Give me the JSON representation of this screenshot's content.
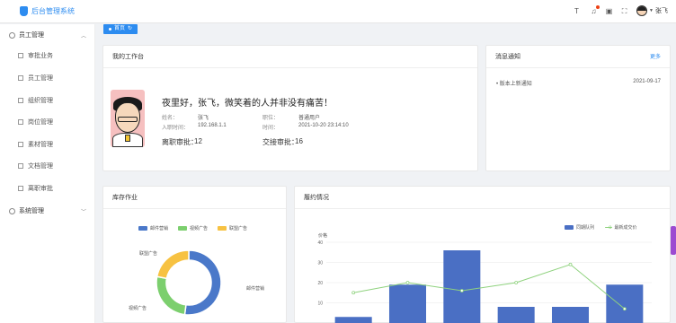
{
  "app": {
    "title": "后台管理系统"
  },
  "user": {
    "name": "张飞"
  },
  "sidebar": {
    "groups": [
      {
        "label": "员工管理",
        "arrow": "^"
      },
      {
        "label": "系统管理",
        "arrow": "v"
      }
    ],
    "items": [
      {
        "label": "审批业务"
      },
      {
        "label": "员工管理"
      },
      {
        "label": "组织管理"
      },
      {
        "label": "岗位管理"
      },
      {
        "label": "素材管理"
      },
      {
        "label": "文档管理"
      },
      {
        "label": "离职审批"
      }
    ]
  },
  "tabs": [
    {
      "label": "首页"
    }
  ],
  "workbench": {
    "title": "我的工作台",
    "greeting": "夜里好，张飞，微笑着的人并非没有痛苦！",
    "fields": {
      "name_label": "姓名：",
      "name_value": "张飞",
      "post_label": "职位：",
      "post_value": "普通用户",
      "ip_label": "入职时间：",
      "ip_value": "192.168.1.1",
      "time_label": "时间：",
      "time_value": "2021-10-20 23:14:10"
    },
    "resign_label": "离职审批：",
    "resign_value": "12",
    "handover_label": "交接审批：",
    "handover_value": "16"
  },
  "notice": {
    "title": "消息通知",
    "more": "更多",
    "items": [
      {
        "text": "版本上新通知",
        "date": "2021-09-17"
      }
    ]
  },
  "stock": {
    "title": "库存作业",
    "chart_data": {
      "type": "pie",
      "labels": [
        "邮件营销",
        "视频广告",
        "联盟广告"
      ],
      "values": [
        52,
        26,
        22
      ],
      "colors": [
        "#4a78c9",
        "#7ccf6e",
        "#f7c242"
      ]
    }
  },
  "performance": {
    "title": "履约情况",
    "chart_data": {
      "type": "bar",
      "ylabel": "价格",
      "ylim": [
        0,
        40
      ],
      "yticks": [
        "40",
        "30",
        "20",
        "10"
      ],
      "series": [
        {
          "name": "同期队列",
          "values": [
            3,
            19,
            36,
            8,
            8,
            19
          ],
          "color": "#4a6fc4"
        },
        {
          "name": "最新成交价",
          "values": [
            15,
            20,
            16,
            20,
            29,
            7
          ],
          "color": "#8fd27e"
        }
      ]
    }
  }
}
